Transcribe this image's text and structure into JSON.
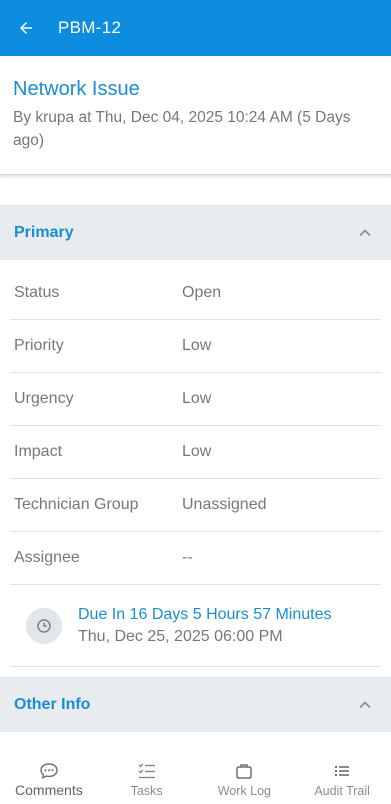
{
  "appbar": {
    "title": "PBM-12"
  },
  "ticket": {
    "subject": "Network Issue",
    "meta": "By krupa at Thu, Dec 04, 2025 10:24 AM (5 Days ago)"
  },
  "primary": {
    "title": "Primary",
    "fields": [
      {
        "label": "Status",
        "value": "Open"
      },
      {
        "label": "Priority",
        "value": "Low"
      },
      {
        "label": "Urgency",
        "value": "Low"
      },
      {
        "label": "Impact",
        "value": "Low"
      },
      {
        "label": "Technician Group",
        "value": "Unassigned"
      },
      {
        "label": "Assignee",
        "value": "--"
      }
    ],
    "due": {
      "label": "Due In 16 Days 5 Hours 57 Minutes",
      "date": "Thu, Dec 25, 2025 06:00 PM"
    }
  },
  "other_info": {
    "title": "Other Info"
  },
  "bottom_nav": [
    {
      "label": "Comments",
      "icon": "comment-icon",
      "active": true
    },
    {
      "label": "Tasks",
      "icon": "tasks-icon",
      "active": false
    },
    {
      "label": "Work Log",
      "icon": "briefcase-icon",
      "active": false
    },
    {
      "label": "Audit Trail",
      "icon": "list-icon",
      "active": false
    }
  ],
  "colors": {
    "appbar": "#0c8de0",
    "accent": "#1a8ed4",
    "section_bg": "#e8ecef",
    "text": "#75787b"
  }
}
